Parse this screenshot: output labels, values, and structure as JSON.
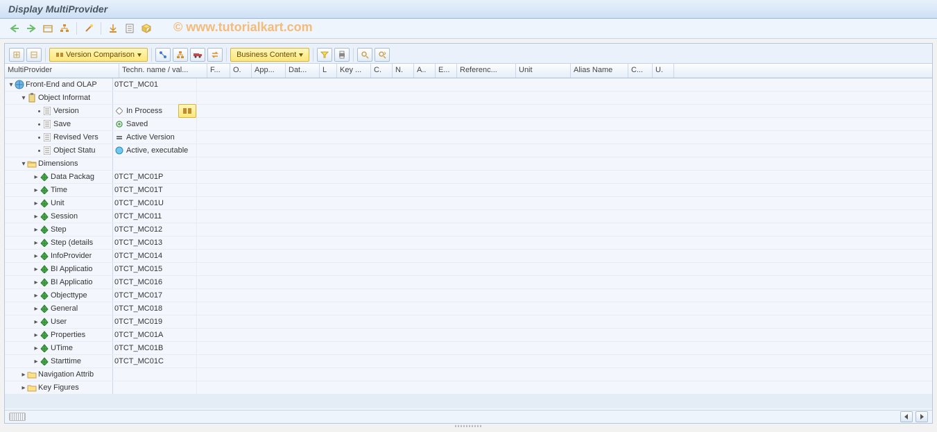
{
  "title": "Display MultiProvider",
  "watermark": "© www.tutorialkart.com",
  "panel_toolbar": {
    "version_comparison": "Version Comparison",
    "business_content": "Business Content"
  },
  "columns": {
    "c1": "MultiProvider",
    "c2": "Techn. name / val...",
    "c3": "F...",
    "c4": "O.",
    "c5": "App...",
    "c6": "Dat...",
    "c7": "L",
    "c8": "Key ...",
    "c9": "C.",
    "c10": "N.",
    "c11": "A..",
    "c12": "E...",
    "c13": "Referenc...",
    "c14": "Unit",
    "c15": "Alias Name",
    "c16": "C...",
    "c17": "U."
  },
  "tree": {
    "root": {
      "label": "Front-End and OLAP",
      "tech": "0TCT_MC01"
    },
    "obj_info": {
      "label": "Object Informat"
    },
    "version": {
      "label": "Version",
      "status": "In Process"
    },
    "save": {
      "label": "Save",
      "status": "Saved"
    },
    "revised": {
      "label": "Revised Vers",
      "status": "Active Version"
    },
    "objstatus": {
      "label": "Object Statu",
      "status": "Active, executable"
    },
    "dimensions": {
      "label": "Dimensions"
    },
    "dims": [
      {
        "label": "Data Packag",
        "tech": "0TCT_MC01P"
      },
      {
        "label": "Time",
        "tech": "0TCT_MC01T"
      },
      {
        "label": "Unit",
        "tech": "0TCT_MC01U"
      },
      {
        "label": "Session",
        "tech": "0TCT_MC011"
      },
      {
        "label": "Step",
        "tech": "0TCT_MC012"
      },
      {
        "label": "Step (details",
        "tech": "0TCT_MC013"
      },
      {
        "label": "InfoProvider",
        "tech": "0TCT_MC014"
      },
      {
        "label": "BI Applicatio",
        "tech": "0TCT_MC015"
      },
      {
        "label": "BI Applicatio",
        "tech": "0TCT_MC016"
      },
      {
        "label": "Objecttype",
        "tech": "0TCT_MC017"
      },
      {
        "label": "General",
        "tech": "0TCT_MC018"
      },
      {
        "label": "User",
        "tech": "0TCT_MC019"
      },
      {
        "label": "Properties",
        "tech": "0TCT_MC01A"
      },
      {
        "label": "UTime",
        "tech": "0TCT_MC01B"
      },
      {
        "label": "Starttime",
        "tech": "0TCT_MC01C"
      }
    ],
    "nav_attr": {
      "label": "Navigation Attrib"
    },
    "key_figures": {
      "label": "Key Figures"
    }
  }
}
